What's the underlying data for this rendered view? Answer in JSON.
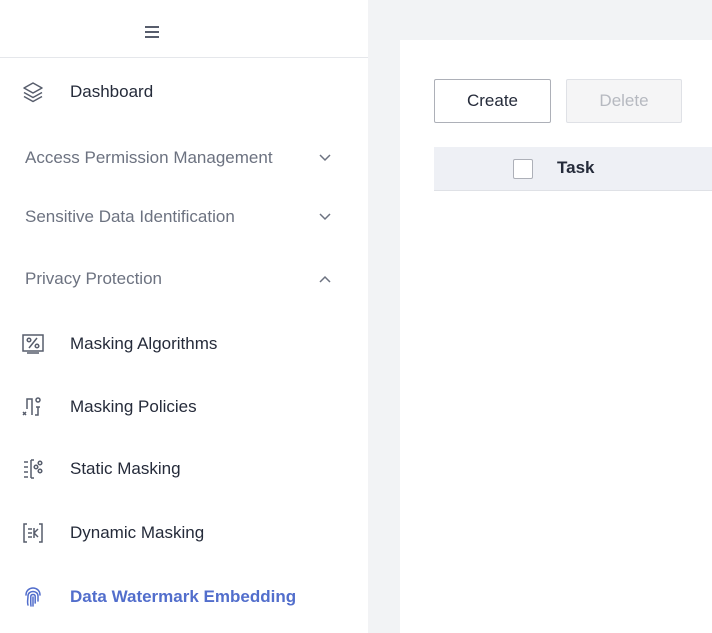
{
  "sidebar": {
    "toggle_icon": "hamburger-icon",
    "items": [
      {
        "label": "Dashboard",
        "icon": "layers-icon"
      },
      {
        "label": "Access Permission Management",
        "chevron": "chevron-down-icon"
      },
      {
        "label": "Sensitive Data Identification",
        "chevron": "chevron-down-icon"
      },
      {
        "label": "Privacy Protection",
        "chevron": "chevron-up-icon"
      },
      {
        "label": "Masking Algorithms",
        "icon": "percent-box-icon"
      },
      {
        "label": "Masking Policies",
        "icon": "masking-policies-icon"
      },
      {
        "label": "Static Masking",
        "icon": "static-masking-icon"
      },
      {
        "label": "Dynamic Masking",
        "icon": "dynamic-masking-icon"
      },
      {
        "label": "Data Watermark Embedding",
        "icon": "fingerprint-icon",
        "active": true
      }
    ]
  },
  "toolbar": {
    "create_label": "Create",
    "delete_label": "Delete"
  },
  "table": {
    "columns": [
      "Task"
    ]
  },
  "colors": {
    "accent": "#526ecc",
    "main_background": "#f2f3f5",
    "table_header_bg": "#eef0f5"
  }
}
